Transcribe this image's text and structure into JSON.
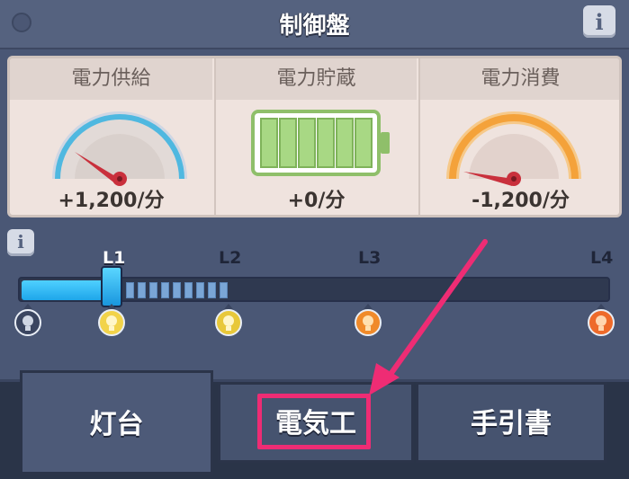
{
  "header": {
    "title": "制御盤",
    "info_icon": "i"
  },
  "stats": {
    "supply": {
      "label": "電力供給",
      "value": "+1,200/分",
      "gauge_level": 0.3
    },
    "storage": {
      "label": "電力貯蔵",
      "value": "+0/分",
      "battery_segments": 6
    },
    "consumption": {
      "label": "電力消費",
      "value": "-1,200/分",
      "gauge_level": 0.1
    }
  },
  "levels": {
    "info_icon": "i",
    "labels": [
      "L1",
      "L2",
      "L3",
      "L4"
    ],
    "current": "L1",
    "bulb_colors": [
      "#3a4560",
      "#f2d34a",
      "#e8c83a",
      "#f08a2a",
      "#ee6a2a"
    ]
  },
  "tabs": [
    {
      "label": "灯台",
      "active": true
    },
    {
      "label": "電気工",
      "active": false,
      "highlighted": true
    },
    {
      "label": "手引書",
      "active": false
    }
  ],
  "colors": {
    "highlight": "#ee2c74",
    "bar_fill": "#1ea6ea"
  }
}
